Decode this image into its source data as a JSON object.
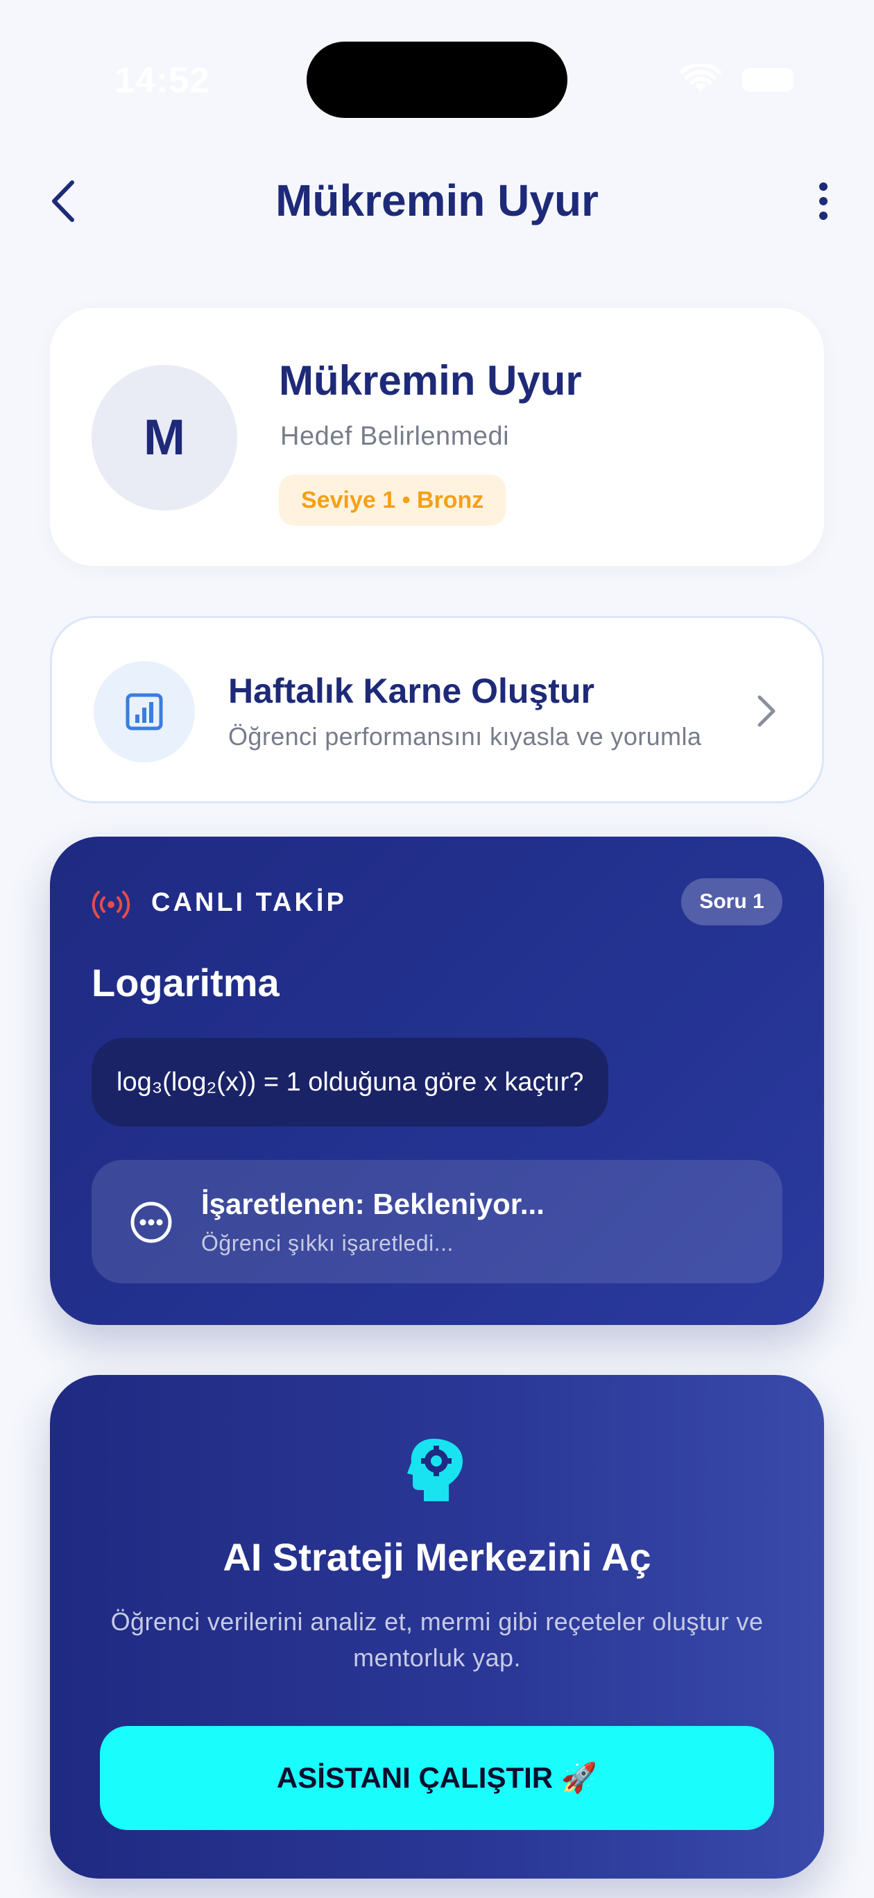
{
  "status_bar": {
    "time": "14:52"
  },
  "header": {
    "title": "Mükremin Uyur"
  },
  "profile": {
    "avatar_initial": "M",
    "name": "Mükremin Uyur",
    "goal": "Hedef Belirlenmedi",
    "level_badge": "Seviye 1 • Bronz"
  },
  "weekly_report": {
    "title": "Haftalık Karne Oluştur",
    "subtitle": "Öğrenci performansını kıyasla ve yorumla"
  },
  "live_tracking": {
    "label": "CANLI TAKİP",
    "question_badge": "Soru 1",
    "topic": "Logaritma",
    "question": "log₃(log₂(x)) = 1 olduğuna göre x kaçtır?",
    "answer_title": "İşaretlenen: Bekleniyor...",
    "answer_subtitle": "Öğrenci şıkkı işaretledi..."
  },
  "ai_center": {
    "title": "AI Strateji Merkezini Aç",
    "description": "Öğrenci verilerini analiz et, mermi gibi reçeteler oluştur ve mentorluk yap.",
    "button_label": "ASİSTANI ÇALIŞTIR 🚀"
  },
  "colors": {
    "primary": "#1e2a78",
    "accent_cyan": "#19fdfd",
    "badge_orange": "#f5a016",
    "live_red": "#e84b4b"
  },
  "icons": [
    "wifi-icon",
    "battery-icon",
    "back-arrow-icon",
    "more-vertical-icon",
    "bar-chart-icon",
    "chevron-right-icon",
    "broadcast-icon",
    "more-horizontal-icon",
    "brain-gear-icon"
  ]
}
